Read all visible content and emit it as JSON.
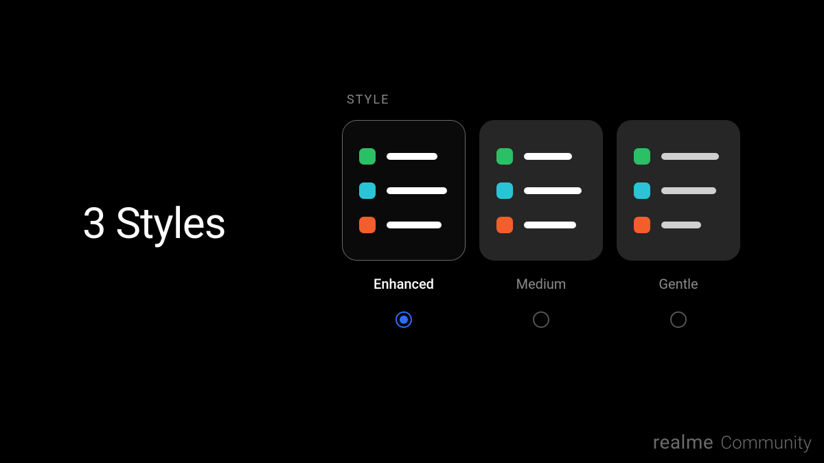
{
  "heading": "3 Styles",
  "section_label": "STYLE",
  "colors": {
    "green": "#2bbf66",
    "cyan": "#2bc3d6",
    "orange": "#f45d2c",
    "accent": "#2e6cff"
  },
  "options": [
    {
      "label": "Enhanced",
      "selected": true
    },
    {
      "label": "Medium",
      "selected": false
    },
    {
      "label": "Gentle",
      "selected": false
    }
  ],
  "bar_widths": {
    "enhanced": [
      74,
      88,
      80
    ],
    "medium": [
      70,
      84,
      76
    ],
    "gentle": [
      84,
      80,
      58
    ]
  },
  "watermark": {
    "brand": "realme",
    "sub": "Community"
  }
}
